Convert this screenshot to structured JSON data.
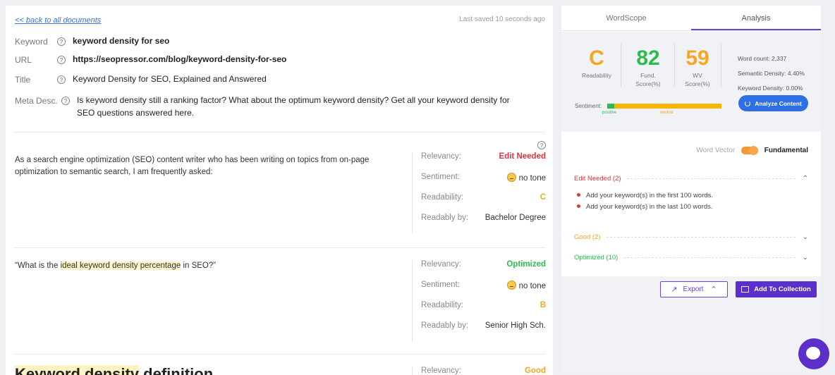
{
  "doc": {
    "back_link": "<< back to all documents",
    "last_saved": "Last saved 10 seconds ago",
    "meta": {
      "keyword_label": "Keyword",
      "keyword_value": "keyword density for seo",
      "url_label": "URL",
      "url_value": "https://seopressor.com/blog/keyword-density-for-seo",
      "title_label": "Title",
      "title_value": "Keyword Density for SEO, Explained and Answered",
      "desc_label": "Meta Desc.",
      "desc_value": "Is keyword density still a ranking factor? What about the optimum keyword density? Get all your keyword density for SEO questions answered here."
    },
    "help_glyph": "?",
    "blocks": [
      {
        "text": "As a search engine optimization (SEO) content writer who has been writing on topics from on-page optimization to semantic search, I am frequently asked:",
        "relevancy_label": "Relevancy:",
        "relevancy": "Edit Needed",
        "sentiment_label": "Sentiment:",
        "sentiment": "no tone",
        "readability_label": "Readability:",
        "readability": "C",
        "readably_label": "Readably by:",
        "readably": "Bachelor Degree"
      },
      {
        "text_before": "“What is the ",
        "text_hl": "ideal keyword density percentage",
        "text_after": " in SEO?”",
        "relevancy_label": "Relevancy:",
        "relevancy": "Optimized",
        "sentiment_label": "Sentiment:",
        "sentiment": "no tone",
        "readability_label": "Readability:",
        "readability": "B",
        "readably_label": "Readably by:",
        "readably": "Senior High Sch."
      },
      {
        "heading_hl": "Keyword density",
        "heading_rest": " definition",
        "relevancy_label": "Relevancy:",
        "relevancy": "Good"
      }
    ]
  },
  "side": {
    "tabs": [
      "WordScope",
      "Analysis"
    ],
    "active_tab": "Analysis",
    "scores": {
      "readability": "C",
      "readability_label": "Readability",
      "fund": "82",
      "fund_label_1": "Fund.",
      "fund_label_2": "Score(%)",
      "wv": "59",
      "wv_label_1": "WV",
      "wv_label_2": "Score(%)"
    },
    "stats": {
      "word_count": "Word count: 2,337",
      "semantic_density": "Semantic Density: 4.40%",
      "keyword_density": "Keyword Density: 0.00%"
    },
    "sentiment": {
      "label": "Sentiment:",
      "positive": "positive",
      "neutral": "neutral"
    },
    "analyze_label": "Analyze Content",
    "toggle": {
      "left_label": "Word Vector",
      "right_label": "Fundamental"
    },
    "accordion": {
      "edit_needed": "Edit Needed (2)",
      "edit_items": [
        "Add your keyword(s) in the first 100 words.",
        "Add your keyword(s) in the last 100 words."
      ],
      "good": "Good (2)",
      "optimized": "Optimized (10)"
    },
    "export_label": "Export",
    "collection_label": "Add To Collection"
  },
  "colors": {
    "accent": "#6c3fe0",
    "red": "#d9363e",
    "green": "#2dbb4e",
    "orange": "#f5a623",
    "blue": "#2f6fe6"
  }
}
